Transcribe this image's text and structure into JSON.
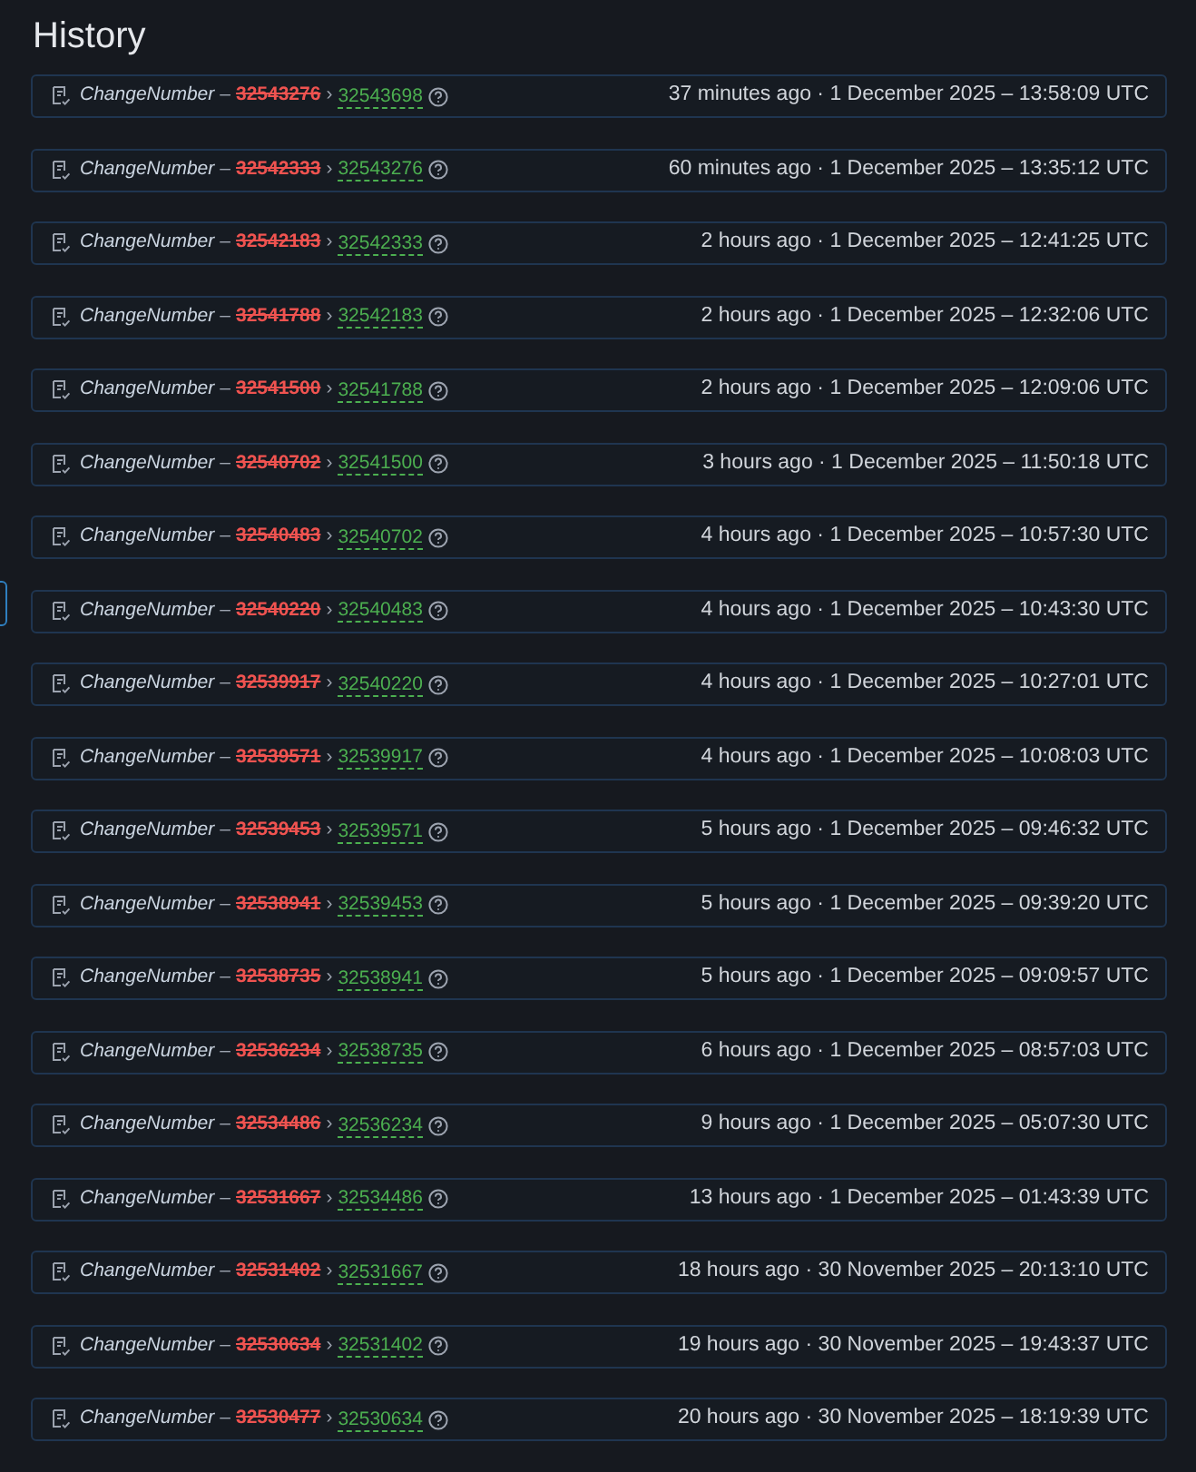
{
  "title": "History",
  "rows": [
    {
      "label": "ChangeNumber",
      "dash": "–",
      "old": "32543276",
      "arrow": "›",
      "new": "32543698",
      "time": "37 minutes ago · 1 December 2025 – 13:58:09 UTC"
    },
    {
      "label": "ChangeNumber",
      "dash": "–",
      "old": "32542333",
      "arrow": "›",
      "new": "32543276",
      "time": "60 minutes ago · 1 December 2025 – 13:35:12 UTC"
    },
    {
      "label": "ChangeNumber",
      "dash": "–",
      "old": "32542183",
      "arrow": "›",
      "new": "32542333",
      "time": "2 hours ago · 1 December 2025 – 12:41:25 UTC"
    },
    {
      "label": "ChangeNumber",
      "dash": "–",
      "old": "32541788",
      "arrow": "›",
      "new": "32542183",
      "time": "2 hours ago · 1 December 2025 – 12:32:06 UTC"
    },
    {
      "label": "ChangeNumber",
      "dash": "–",
      "old": "32541500",
      "arrow": "›",
      "new": "32541788",
      "time": "2 hours ago · 1 December 2025 – 12:09:06 UTC"
    },
    {
      "label": "ChangeNumber",
      "dash": "–",
      "old": "32540702",
      "arrow": "›",
      "new": "32541500",
      "time": "3 hours ago · 1 December 2025 – 11:50:18 UTC"
    },
    {
      "label": "ChangeNumber",
      "dash": "–",
      "old": "32540483",
      "arrow": "›",
      "new": "32540702",
      "time": "4 hours ago · 1 December 2025 – 10:57:30 UTC"
    },
    {
      "label": "ChangeNumber",
      "dash": "–",
      "old": "32540220",
      "arrow": "›",
      "new": "32540483",
      "time": "4 hours ago · 1 December 2025 – 10:43:30 UTC"
    },
    {
      "label": "ChangeNumber",
      "dash": "–",
      "old": "32539917",
      "arrow": "›",
      "new": "32540220",
      "time": "4 hours ago · 1 December 2025 – 10:27:01 UTC"
    },
    {
      "label": "ChangeNumber",
      "dash": "–",
      "old": "32539571",
      "arrow": "›",
      "new": "32539917",
      "time": "4 hours ago · 1 December 2025 – 10:08:03 UTC"
    },
    {
      "label": "ChangeNumber",
      "dash": "–",
      "old": "32539453",
      "arrow": "›",
      "new": "32539571",
      "time": "5 hours ago · 1 December 2025 – 09:46:32 UTC"
    },
    {
      "label": "ChangeNumber",
      "dash": "–",
      "old": "32538941",
      "arrow": "›",
      "new": "32539453",
      "time": "5 hours ago · 1 December 2025 – 09:39:20 UTC"
    },
    {
      "label": "ChangeNumber",
      "dash": "–",
      "old": "32538735",
      "arrow": "›",
      "new": "32538941",
      "time": "5 hours ago · 1 December 2025 – 09:09:57 UTC"
    },
    {
      "label": "ChangeNumber",
      "dash": "–",
      "old": "32536234",
      "arrow": "›",
      "new": "32538735",
      "time": "6 hours ago · 1 December 2025 – 08:57:03 UTC"
    },
    {
      "label": "ChangeNumber",
      "dash": "–",
      "old": "32534486",
      "arrow": "›",
      "new": "32536234",
      "time": "9 hours ago · 1 December 2025 – 05:07:30 UTC"
    },
    {
      "label": "ChangeNumber",
      "dash": "–",
      "old": "32531667",
      "arrow": "›",
      "new": "32534486",
      "time": "13 hours ago · 1 December 2025 – 01:43:39 UTC"
    },
    {
      "label": "ChangeNumber",
      "dash": "–",
      "old": "32531402",
      "arrow": "›",
      "new": "32531667",
      "time": "18 hours ago · 30 November 2025 – 20:13:10 UTC"
    },
    {
      "label": "ChangeNumber",
      "dash": "–",
      "old": "32530634",
      "arrow": "›",
      "new": "32531402",
      "time": "19 hours ago · 30 November 2025 – 19:43:37 UTC"
    },
    {
      "label": "ChangeNumber",
      "dash": "–",
      "old": "32530477",
      "arrow": "›",
      "new": "32530634",
      "time": "20 hours ago · 30 November 2025 – 18:19:39 UTC"
    }
  ]
}
